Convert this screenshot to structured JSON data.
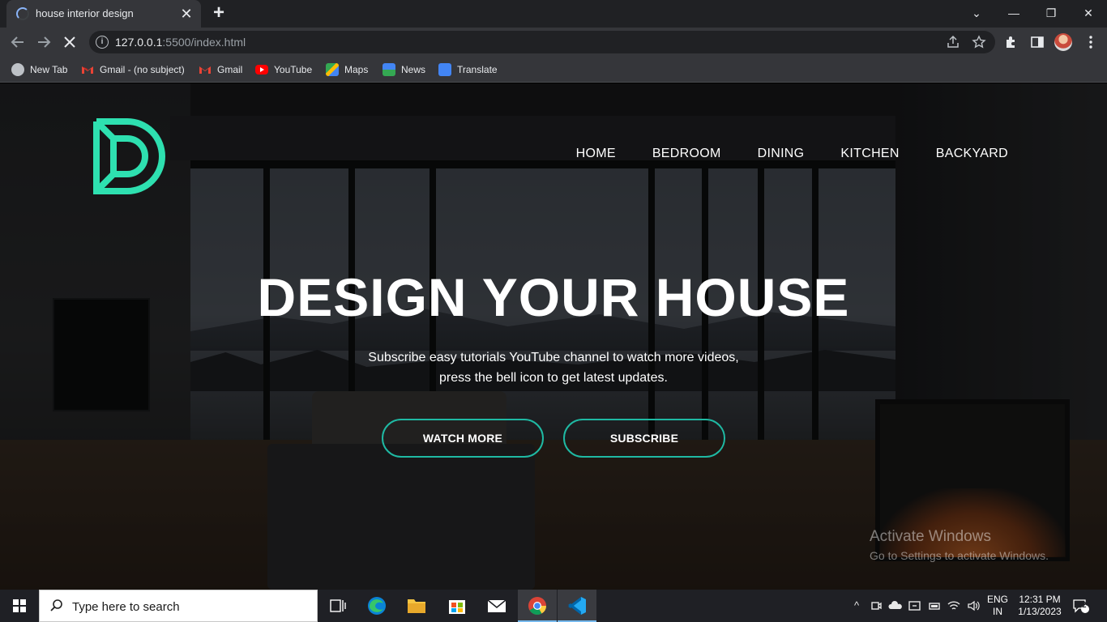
{
  "browser": {
    "tab_title": "house interior design",
    "tab_close": "✕",
    "new_tab": "+",
    "url_host": "127.0.0.1",
    "url_path": ":5500/index.html",
    "window_controls": {
      "minimize": "—",
      "restore": "❐",
      "close": "✕",
      "dropdown": "⌄"
    },
    "bookmarks": [
      {
        "label": "New Tab",
        "icon": "globe-icon"
      },
      {
        "label": "Gmail - (no subject)",
        "icon": "gmail-icon"
      },
      {
        "label": "Gmail",
        "icon": "gmail-icon"
      },
      {
        "label": "YouTube",
        "icon": "youtube-icon"
      },
      {
        "label": "Maps",
        "icon": "maps-icon"
      },
      {
        "label": "News",
        "icon": "news-icon"
      },
      {
        "label": "Translate",
        "icon": "translate-icon"
      }
    ]
  },
  "site": {
    "logo_letter": "D",
    "nav": [
      "HOME",
      "BEDROOM",
      "DINING",
      "KITCHEN",
      "BACKYARD"
    ],
    "hero_title": "DESIGN YOUR HOUSE",
    "hero_sub_line1": "Subscribe easy tutorials YouTube channel to watch more videos,",
    "hero_sub_line2": "press the bell icon to get latest updates.",
    "buttons": {
      "watch_more": "WATCH MORE",
      "subscribe": "SUBSCRIBE"
    },
    "accent_color": "#1fb9a3",
    "logo_color": "#2ee0b0"
  },
  "watermark": {
    "line1": "Activate Windows",
    "line2": "Go to Settings to activate Windows."
  },
  "taskbar": {
    "search_placeholder": "Type here to search",
    "lang_line1": "ENG",
    "lang_line2": "IN",
    "time": "12:31 PM",
    "date": "1/13/2023",
    "notification_count": "2"
  }
}
